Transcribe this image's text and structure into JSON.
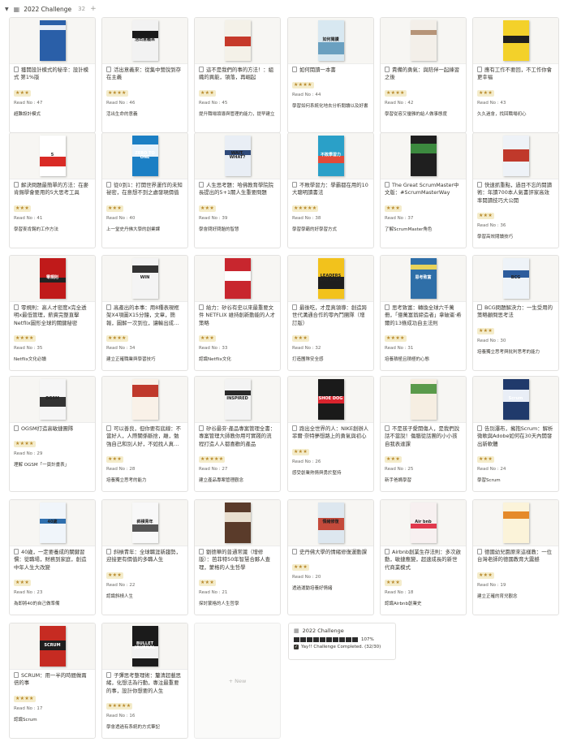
{
  "header": {
    "title": "2022 Challenge",
    "count": "32",
    "plus": "+"
  },
  "new_label": "+ New",
  "challenge_card": {
    "title": "2022 Challenge",
    "percent": "107%",
    "progress_fraction": 1.07,
    "completed_text": "Yay!! Challenge Completed. (32/30)"
  },
  "colors": {
    "accent_star": "#b98a2c",
    "star_bg": "#f4eccb",
    "border": "#e3e2e0"
  },
  "books": [
    {
      "title": "獲開設計模式的秘辛：設計模式 第1%版",
      "stars": "★★★",
      "read": "Read No : 47",
      "note": "超難設計模式",
      "cover": "#2a5fa8",
      "cover2": "#e9eef6",
      "ctext": ""
    },
    {
      "title": "活出意義來：從集中營說到存在主義",
      "stars": "★★★★",
      "read": "Read No : 46",
      "note": "活出生命的意義",
      "cover": "#f2f2f2",
      "cover2": "#1a1a1a",
      "ctext": "活出意義來"
    },
    {
      "title": "這不是我們的事的方法！：組織的異能，領落，再崛起",
      "stars": "★★★",
      "read": "Read No : 45",
      "note": "提升職場領導與管理的能力，提早建立",
      "cover": "#f4f1e8",
      "cover2": "#c63a2a",
      "ctext": ""
    },
    {
      "title": "如何閱讀一本書",
      "stars": "★★★★",
      "read": "Read No : 44",
      "note": "學習如何系統化地去分析閱讀以及好書",
      "cover": "#d8e8f1",
      "cover2": "#6aa0c0",
      "ctext": "如何閱讀"
    },
    {
      "title": "責備的勇氣：與陪伴一起練習之後",
      "stars": "★★★★",
      "read": "Read No : 42",
      "note": "學習從容又優雅的給人做事態度",
      "cover": "#f3efe9",
      "cover2": "#b69478",
      "ctext": ""
    },
    {
      "title": "應有工作不要回，不工作你會更幸福",
      "stars": "★★★",
      "read": "Read No : 43",
      "note": "久久過會，找回職場初心",
      "cover": "#f3d12a",
      "cover2": "#1f1f1f",
      "ctext": "擁抱人生"
    },
    {
      "title": "解決問題最簡單的方法：在麥肯錫學會要用的5大思考工具",
      "stars": "★★★",
      "read": "Read No : 41",
      "note": "學習麥肯錫的工作方法",
      "cover": "#ffffff",
      "cover2": "#d92b26",
      "ctext": "5"
    },
    {
      "title": "從0到1：打開世界運作的未知祕密，在意想不到之處發現價值",
      "stars": "★★★",
      "read": "Read No : 40",
      "note": "上一堂史丹佛大學的創業課",
      "cover": "#1b7fc4",
      "cover2": "#e9f3fb",
      "ctext": "ZERO TO ONE"
    },
    {
      "title": "人生思考題：哈佛教育學院院長提出的5+1關人生重要問題",
      "stars": "★★★",
      "read": "Read No : 39",
      "note": "學會問好問題的智慧",
      "cover": "#e9eef5",
      "cover2": "#2f4a7a",
      "ctext": "WAIT, WHAT?"
    },
    {
      "title": "不敗學習力：學霸都在用的10大聰明讀書法",
      "stars": "★★★★★",
      "read": "Read No : 38",
      "note": "學習學霸的好學習方式",
      "cover": "#2aa0c8",
      "cover2": "#e24a39",
      "ctext": "不敗學習力"
    },
    {
      "title": "The Great ScrumMaster中文版：#ScrumMasterWay",
      "stars": "★★★",
      "read": "Read No : 37",
      "note": "了解ScrumMaster角色",
      "cover": "#1f1f1f",
      "cover2": "#3c8a3f",
      "ctext": ""
    },
    {
      "title": "快速抓重點，過目不忘的閱讀術：年讀700本人氣書評家高效率閱讀技巧大公開",
      "stars": "★★★",
      "read": "Read No : 36",
      "note": "學習高效閱讀技巧",
      "cover": "#eef2f7",
      "cover2": "#c0392b",
      "ctext": ""
    },
    {
      "title": "零規則：高人才密度x完全透明x最低管理，薪資完整直擊Netflix圖形全球的關鍵秘密",
      "stars": "★★★★",
      "read": "Read No : 35",
      "note": "Netflix文化必讀",
      "cover": "#c01a1a",
      "cover2": "#222222",
      "ctext": "零規則"
    },
    {
      "title": "高產出的本事：用8種表現框架X4項圖X15分鐘，文章，簡報，圖解一次到位，讓輸出成為你的優勢",
      "stars": "★★★★",
      "read": "Read No : 34",
      "note": "建立正確職業與學習技巧",
      "cover": "#f4f4f4",
      "cover2": "#333333",
      "ctext": "WIN"
    },
    {
      "title": "給力：矽谷有史以來最重要文件 NETFLIX 維持創新動能的人才策略",
      "stars": "★★★",
      "read": "Read No : 33",
      "note": "認識Netflix文化",
      "cover": "#c8262e",
      "cover2": "#ffffff",
      "ctext": "給力"
    },
    {
      "title": "最後吃，才是真領導：創造跨世代溝通合作的零內鬥團隊（增訂版）",
      "stars": "★★★",
      "read": "Read No : 32",
      "note": "打造團隊安全感",
      "cover": "#f2c21c",
      "cover2": "#1e1e1e",
      "ctext": "LEADERS EAT LAST"
    },
    {
      "title": "思考致富：轉換全球六千萬冊，「億萬富翁締造者」拿破崙·希爾的13條成功自主法則",
      "stars": "★★★★",
      "read": "Read No : 31",
      "note": "培養積極且積極的心態",
      "cover": "#2f6fa8",
      "cover2": "#e8d35a",
      "ctext": "思考致富"
    },
    {
      "title": "BCG問題解決力：一生受用的策略顧問思考法",
      "stars": "★★★",
      "read": "Read No : 30",
      "note": "培養獨立思考與批判思考的能力",
      "cover": "#eef3f8",
      "cover2": "#2d5c9c",
      "ctext": "BCG"
    },
    {
      "title": "OGSM打造高敏捷團隊",
      "stars": "★★★★",
      "read": "Read No : 29",
      "note": "理解 OGSM「一頁計畫表」",
      "cover": "#f6f6f6",
      "cover2": "#333333",
      "ctext": "OGSM"
    },
    {
      "title": "可以善良，但你要有底線：不當好人，人際關係斷捨，離，勉強自己和別人好，不如找人真心對你好",
      "stars": "★★★",
      "read": "Read No : 28",
      "note": "培養獨立思考的能力",
      "cover": "#f9f1e8",
      "cover2": "#c0392b",
      "ctext": ""
    },
    {
      "title": "矽谷最夯·產品專案管理全書：專案管理大師教你用可實踐的流程打造人人都喜歡的產品",
      "stars": "★★★★★",
      "read": "Read No : 27",
      "note": "建立產品專案管理觀念",
      "cover": "#f3f3f3",
      "cover2": "#2a2a2a",
      "ctext": "INSPIRED"
    },
    {
      "title": "跑出全世界的人：NIKE創辦人菲爾·奈特夢想路上的勇氣與初心",
      "stars": "★★★",
      "read": "Read No : 26",
      "note": "感受創業熱情與勇於堅持",
      "cover": "#1a1a1a",
      "cover2": "#d9232d",
      "ctext": "SHOE DOG"
    },
    {
      "title": "不是孩子愛開傷人，是我們說話不當說！傷腦從話團的小小孩自我表達課",
      "stars": "★★★",
      "read": "Read No : 25",
      "note": "新手爸媽學習",
      "cover": "#f6eee2",
      "cover2": "#5a9a4a",
      "ctext": ""
    },
    {
      "title": "告別瀑布，擁抱Scrum：解析微軟與Adobe如何在30天內開發出新軟體",
      "stars": "★★★",
      "read": "Read No : 24",
      "note": "學習Scrum",
      "cover": "#203a6b",
      "cover2": "#e9eef6",
      "ctext": "Scrum"
    },
    {
      "title": "40歲，一定要養成的關鍵習慣：從職場，財務到家庭，創造中年人生大改變",
      "stars": "★★★",
      "read": "Read No : 23",
      "note": "為即將40的自己做準備",
      "cover": "#f0f5fa",
      "cover2": "#2f6fae",
      "ctext": "40歲"
    },
    {
      "title": "斜槓青年：全球職涯新趨勢，迎接更有價值的多職人生",
      "stars": "★★★",
      "read": "Read No : 22",
      "note": "認識斜槓人生",
      "cover": "#f8f8f8",
      "cover2": "#555555",
      "ctext": "斜槓青年"
    },
    {
      "title": "劉德華的普通常識（增修版）：芭菲特50年智慧合夥人查理，蒙格的人生哲學",
      "stars": "★★★",
      "read": "Read No : 21",
      "note": "探討蒙格的人生哲學",
      "cover": "#5a3b2a",
      "cover2": "#e9dfcf",
      "ctext": ""
    },
    {
      "title": "史丹佛大學的情緒修復運動課",
      "stars": "★★★",
      "read": "Read No : 20",
      "note": "透過運動培養好情緒",
      "cover": "#dde7ef",
      "cover2": "#c44a3b",
      "ctext": "情緒修復"
    },
    {
      "title": "Airbnb創業生存法則：多次啟動，敏捷應變，超速成長的新世代商業模式",
      "stars": "★★★",
      "read": "Read No : 18",
      "note": "認識Airbnb創業史",
      "cover": "#f7f0f0",
      "cover2": "#e0394d",
      "ctext": "Air bnb"
    },
    {
      "title": "德國幼兒園原來這樣教：一位台灣老師的德國教育大震撼",
      "stars": "★★★",
      "read": "Read No : 19",
      "note": "建立正確的育兒觀念",
      "cover": "#fbf3d9",
      "cover2": "#e58a2a",
      "ctext": ""
    },
    {
      "title": "SCRUM：用一半的時間做兩倍的事",
      "stars": "★★★★",
      "read": "Read No : 17",
      "note": "認識Scrum",
      "cover": "#c62b22",
      "cover2": "#1e1e1e",
      "ctext": "SCRUM"
    },
    {
      "title": "子彈思考整理術：釐清超載思緒，化想法為行動，專注最重要的事，設計你想要的人生",
      "stars": "★★★★★",
      "read": "Read No : 16",
      "note": "學會透過有系統的方式筆記",
      "cover": "#1b1b1b",
      "cover2": "#f1f1f1",
      "ctext": "BULLET JOURNAL"
    }
  ]
}
